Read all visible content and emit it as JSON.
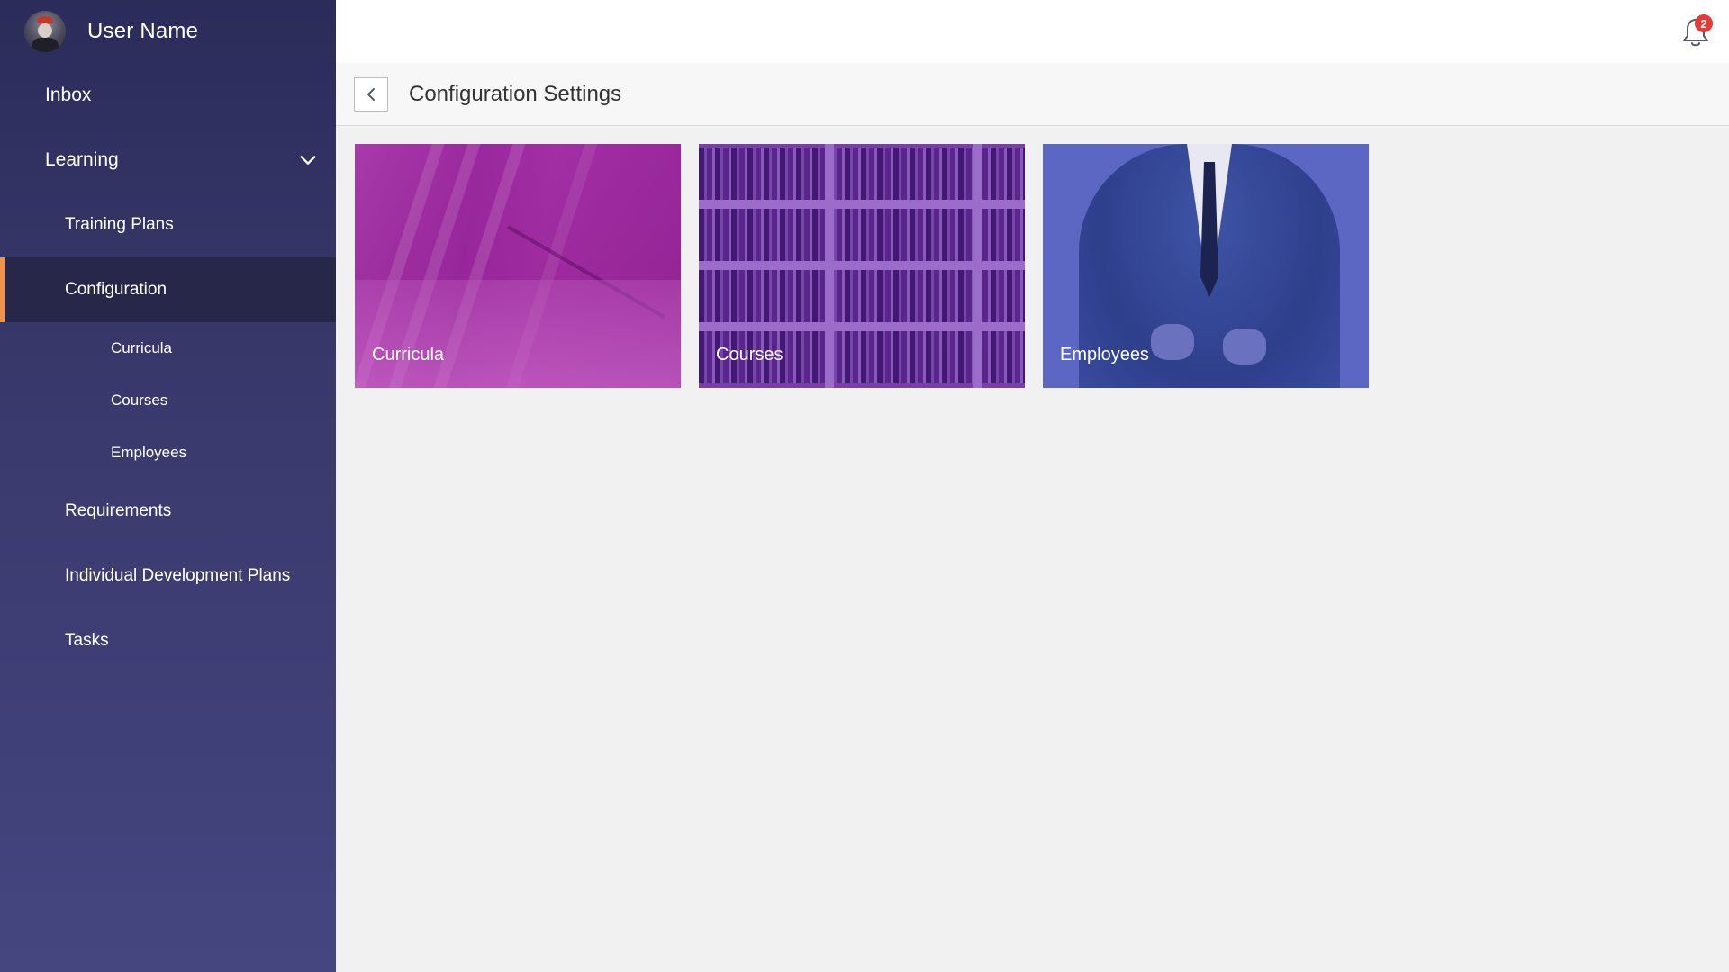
{
  "user": {
    "name": "User Name"
  },
  "sidebar": {
    "items": [
      {
        "label": "Inbox"
      },
      {
        "label": "Learning"
      },
      {
        "label": "Training Plans"
      },
      {
        "label": "Configuration"
      },
      {
        "label": "Curricula"
      },
      {
        "label": "Courses"
      },
      {
        "label": "Employees"
      },
      {
        "label": "Requirements"
      },
      {
        "label": "Individual Development Plans"
      },
      {
        "label": "Tasks"
      }
    ],
    "active_item": "Configuration",
    "active_color": "#f0934a"
  },
  "header": {
    "notification_count": "2",
    "notification_icon": "bell-icon"
  },
  "page": {
    "title": "Configuration Settings",
    "back_icon": "chevron-left-icon"
  },
  "tiles": [
    {
      "label": "Curricula",
      "color": "#a03aa6"
    },
    {
      "label": "Courses",
      "color": "#7a3ea6"
    },
    {
      "label": "Employees",
      "color": "#5b67c2"
    }
  ]
}
